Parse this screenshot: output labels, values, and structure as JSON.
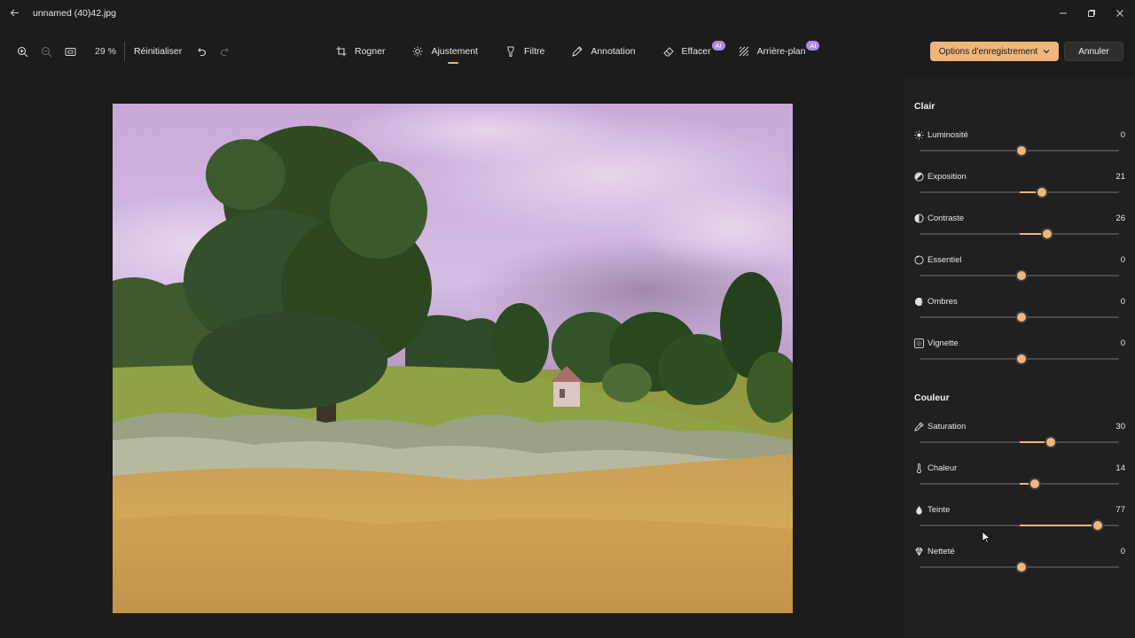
{
  "window": {
    "title": "unnamed (40)42.jpg",
    "minimize_glyph": "—",
    "restore_glyph": "❐",
    "close_glyph": "✕"
  },
  "toolbar": {
    "zoom_value": "29 %",
    "reset_label": "Réinitialiser",
    "icons": [
      "zoom-in-icon",
      "zoom-out-icon",
      "fit-screen-icon",
      "undo-icon",
      "redo-icon"
    ]
  },
  "tools": [
    {
      "label": "Rogner",
      "icon": "crop-icon",
      "active": false,
      "ai": false
    },
    {
      "label": "Ajustement",
      "icon": "brightness-icon",
      "active": true,
      "ai": false
    },
    {
      "label": "Filtre",
      "icon": "filter-icon",
      "active": false,
      "ai": false
    },
    {
      "label": "Annotation",
      "icon": "pen-icon",
      "active": false,
      "ai": false
    },
    {
      "label": "Effacer",
      "icon": "eraser-icon",
      "active": false,
      "ai": true
    },
    {
      "label": "Arrière-plan",
      "icon": "background-icon",
      "active": false,
      "ai": true
    }
  ],
  "ai_badge": "AI",
  "actions": {
    "save_label": "Options d'enregistrement",
    "cancel_label": "Annuler"
  },
  "panel": {
    "light_title": "Clair",
    "color_title": "Couleur",
    "light": [
      {
        "label": "Luminosité",
        "value": "0",
        "level": 0,
        "icon": "sun-icon"
      },
      {
        "label": "Exposition",
        "value": "21",
        "level": 21,
        "icon": "exposure-icon"
      },
      {
        "label": "Contraste",
        "value": "26",
        "level": 26,
        "icon": "contrast-icon"
      },
      {
        "label": "Essentiel",
        "value": "0",
        "level": 0,
        "icon": "highlights-icon"
      },
      {
        "label": "Ombres",
        "value": "0",
        "level": 0,
        "icon": "shadows-icon"
      },
      {
        "label": "Vignette",
        "value": "0",
        "level": 0,
        "icon": "vignette-icon"
      }
    ],
    "color": [
      {
        "label": "Saturation",
        "value": "30",
        "level": 30,
        "icon": "eyedropper-icon"
      },
      {
        "label": "Chaleur",
        "value": "14",
        "level": 14,
        "icon": "thermometer-icon"
      },
      {
        "label": "Teinte",
        "value": "77",
        "level": 77,
        "icon": "droplet-icon"
      },
      {
        "label": "Netteté",
        "value": "0",
        "level": 0,
        "icon": "sharpness-icon"
      }
    ],
    "slider_range": [
      -100,
      100
    ]
  },
  "colors": {
    "accent": "#f0b57a",
    "ai_badge": "#a98be8",
    "background": "#1c1c1c",
    "panel": "#202020"
  }
}
